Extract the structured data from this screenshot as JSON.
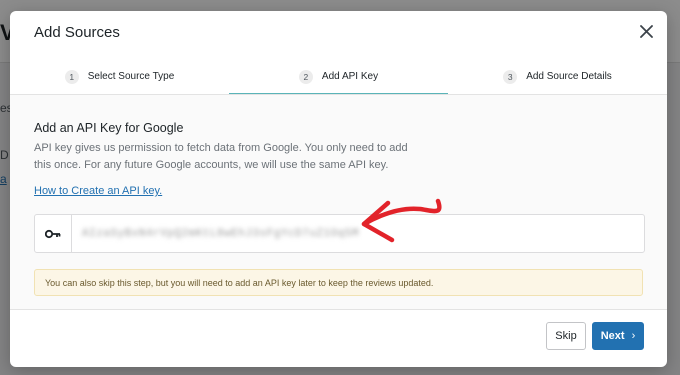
{
  "background": {
    "title_fragment": "V",
    "lines": [
      "es",
      "D",
      "a",
      "l",
      "e"
    ],
    "link_fragment": "a"
  },
  "modal": {
    "title": "Add Sources",
    "close_icon": "close-icon",
    "steps": [
      {
        "number": "1",
        "label": "Select Source Type",
        "active": false
      },
      {
        "number": "2",
        "label": "Add API Key",
        "active": true
      },
      {
        "number": "3",
        "label": "Add Source Details",
        "active": false
      }
    ],
    "section_title": "Add an API Key for Google",
    "description": "API key gives us permission to fetch data from Google. You only need to add this once. For any future Google accounts, we will use the same API key.",
    "help_link": "How to Create an API key.",
    "api_key": {
      "icon": "key-icon",
      "value": "AIzaSyBxN4rVpQ2mKtL8wEhJ3sFgYcD7uZ1Oq5M"
    },
    "notice": "You can also skip this step, but you will need to add an API key later to keep the reviews updated.",
    "buttons": {
      "skip": "Skip",
      "next": "Next"
    },
    "colors": {
      "primary": "#2271b1",
      "active_step_underline": "#5ab4b8",
      "notice_bg": "#fcf6e6",
      "annotation_arrow": "#e2232a"
    }
  }
}
